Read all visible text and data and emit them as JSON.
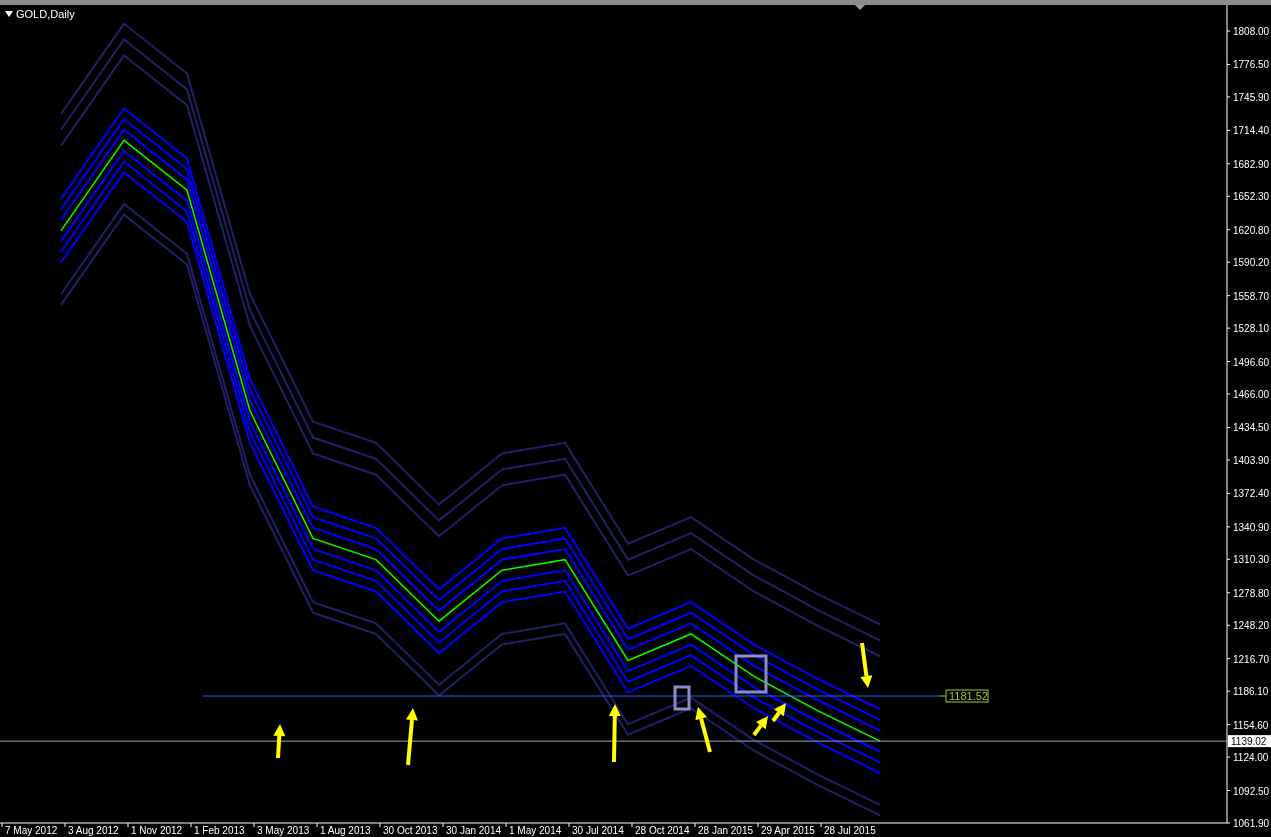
{
  "chart": {
    "title": "GOLD,Daily",
    "chart_data": {
      "type": "line",
      "categories": [
        "7 May 2012",
        "3 Aug 2012",
        "1 Nov 2012",
        "1 Feb 2013",
        "3 May 2013",
        "1 Aug 2013",
        "30 Oct 2013",
        "30 Jan 2014",
        "1 May 2014",
        "30 Jul 2014",
        "28 Oct 2014",
        "28 Jan 2015",
        "29 Apr 2015",
        "28 Jul 2015"
      ],
      "series": [
        {
          "color": "#00ff00",
          "values": [
            1620,
            1705,
            1658,
            1450,
            1330,
            1310,
            1252,
            1300,
            1310,
            1215,
            1240,
            1200,
            1168,
            1139
          ]
        },
        {
          "color": "#20206a",
          "values": [
            1730,
            1815,
            1768,
            1560,
            1440,
            1420,
            1362,
            1410,
            1420,
            1325,
            1350,
            1310,
            1278,
            1249
          ]
        },
        {
          "color": "#20206a",
          "values": [
            1715,
            1800,
            1753,
            1545,
            1425,
            1405,
            1347,
            1395,
            1405,
            1310,
            1335,
            1295,
            1263,
            1234
          ]
        },
        {
          "color": "#20206a",
          "values": [
            1700,
            1785,
            1738,
            1530,
            1410,
            1390,
            1332,
            1380,
            1390,
            1295,
            1320,
            1280,
            1248,
            1219
          ]
        },
        {
          "color": "#0000ff",
          "values": [
            1650,
            1735,
            1688,
            1480,
            1360,
            1340,
            1282,
            1330,
            1340,
            1245,
            1270,
            1230,
            1198,
            1169
          ]
        },
        {
          "color": "#0000ff",
          "values": [
            1640,
            1725,
            1678,
            1470,
            1350,
            1330,
            1272,
            1320,
            1330,
            1235,
            1260,
            1220,
            1188,
            1159
          ]
        },
        {
          "color": "#0000ff",
          "values": [
            1630,
            1715,
            1668,
            1460,
            1340,
            1320,
            1262,
            1310,
            1320,
            1225,
            1250,
            1210,
            1178,
            1149
          ]
        },
        {
          "color": "#0000ff",
          "values": [
            1610,
            1695,
            1648,
            1440,
            1320,
            1300,
            1242,
            1290,
            1300,
            1205,
            1230,
            1190,
            1158,
            1129
          ]
        },
        {
          "color": "#0000ff",
          "values": [
            1600,
            1685,
            1638,
            1430,
            1310,
            1290,
            1232,
            1280,
            1290,
            1195,
            1220,
            1180,
            1148,
            1119
          ]
        },
        {
          "color": "#0000ff",
          "values": [
            1590,
            1675,
            1628,
            1420,
            1300,
            1280,
            1222,
            1270,
            1280,
            1185,
            1210,
            1170,
            1138,
            1109
          ]
        },
        {
          "color": "#20206a",
          "values": [
            1560,
            1645,
            1598,
            1390,
            1270,
            1250,
            1192,
            1240,
            1250,
            1155,
            1180,
            1140,
            1108,
            1079
          ]
        },
        {
          "color": "#20206a",
          "values": [
            1550,
            1635,
            1588,
            1380,
            1260,
            1240,
            1182,
            1230,
            1240,
            1145,
            1170,
            1130,
            1098,
            1069
          ]
        }
      ],
      "ylim": [
        1061.9,
        1832.5
      ],
      "yticks": [
        {
          "value": 1808,
          "label": "1808.00"
        },
        {
          "value": 1776.5,
          "label": "1776.50"
        },
        {
          "value": 1745.9,
          "label": "1745.90"
        },
        {
          "value": 1714.4,
          "label": "1714.40"
        },
        {
          "value": 1682.9,
          "label": "1682.90"
        },
        {
          "value": 1652.3,
          "label": "1652.30"
        },
        {
          "value": 1620.8,
          "label": "1620.80"
        },
        {
          "value": 1590.2,
          "label": "1590.20"
        },
        {
          "value": 1558.7,
          "label": "1558.70"
        },
        {
          "value": 1528.1,
          "label": "1528.10"
        },
        {
          "value": 1496.6,
          "label": "1496.60"
        },
        {
          "value": 1466,
          "label": "1466.00"
        },
        {
          "value": 1434.5,
          "label": "1434.50"
        },
        {
          "value": 1403.9,
          "label": "1403.90"
        },
        {
          "value": 1372.4,
          "label": "1372.40"
        },
        {
          "value": 1340.9,
          "label": "1340.90"
        },
        {
          "value": 1310.3,
          "label": "1310.30"
        },
        {
          "value": 1278.8,
          "label": "1278.80"
        },
        {
          "value": 1248.2,
          "label": "1248.20"
        },
        {
          "value": 1216.7,
          "label": "1216.70"
        },
        {
          "value": 1186.1,
          "label": "1186.10"
        },
        {
          "value": 1154.6,
          "label": "1154.60"
        },
        {
          "value": 1124,
          "label": "1124.00"
        },
        {
          "value": 1092.5,
          "label": "1092.50"
        },
        {
          "value": 1061.9,
          "label": "1061.90"
        }
      ]
    },
    "level_line_label": "1181.52",
    "current_price_label": "1139.02"
  }
}
